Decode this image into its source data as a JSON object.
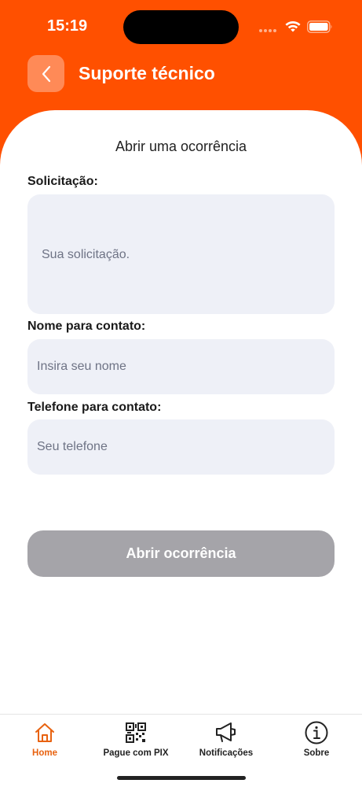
{
  "status_bar": {
    "time": "15:19"
  },
  "header": {
    "title": "Suporte técnico"
  },
  "form": {
    "section_title": "Abrir uma ocorrência",
    "request": {
      "label": "Solicitação:",
      "placeholder": "Sua solicitação.",
      "value": ""
    },
    "contact_name": {
      "label": "Nome para contato:",
      "placeholder": "Insira seu nome",
      "value": ""
    },
    "contact_phone": {
      "label": "Telefone para contato:",
      "placeholder": "Seu telefone",
      "value": ""
    },
    "submit_label": "Abrir ocorrência",
    "submit_enabled": false
  },
  "tab_bar": {
    "items": [
      {
        "label": "Home",
        "icon": "home-icon",
        "active": true
      },
      {
        "label": "Pague com PIX",
        "icon": "qr-code-icon",
        "active": false
      },
      {
        "label": "Notificações",
        "icon": "megaphone-icon",
        "active": false
      },
      {
        "label": "Sobre",
        "icon": "info-icon",
        "active": false
      }
    ]
  },
  "colors": {
    "brand": "#ff5000",
    "back_button": "#ff8a57",
    "input_bg": "#eef0f7",
    "button_disabled": "#a5a4a9",
    "tab_active": "#e8620f"
  }
}
